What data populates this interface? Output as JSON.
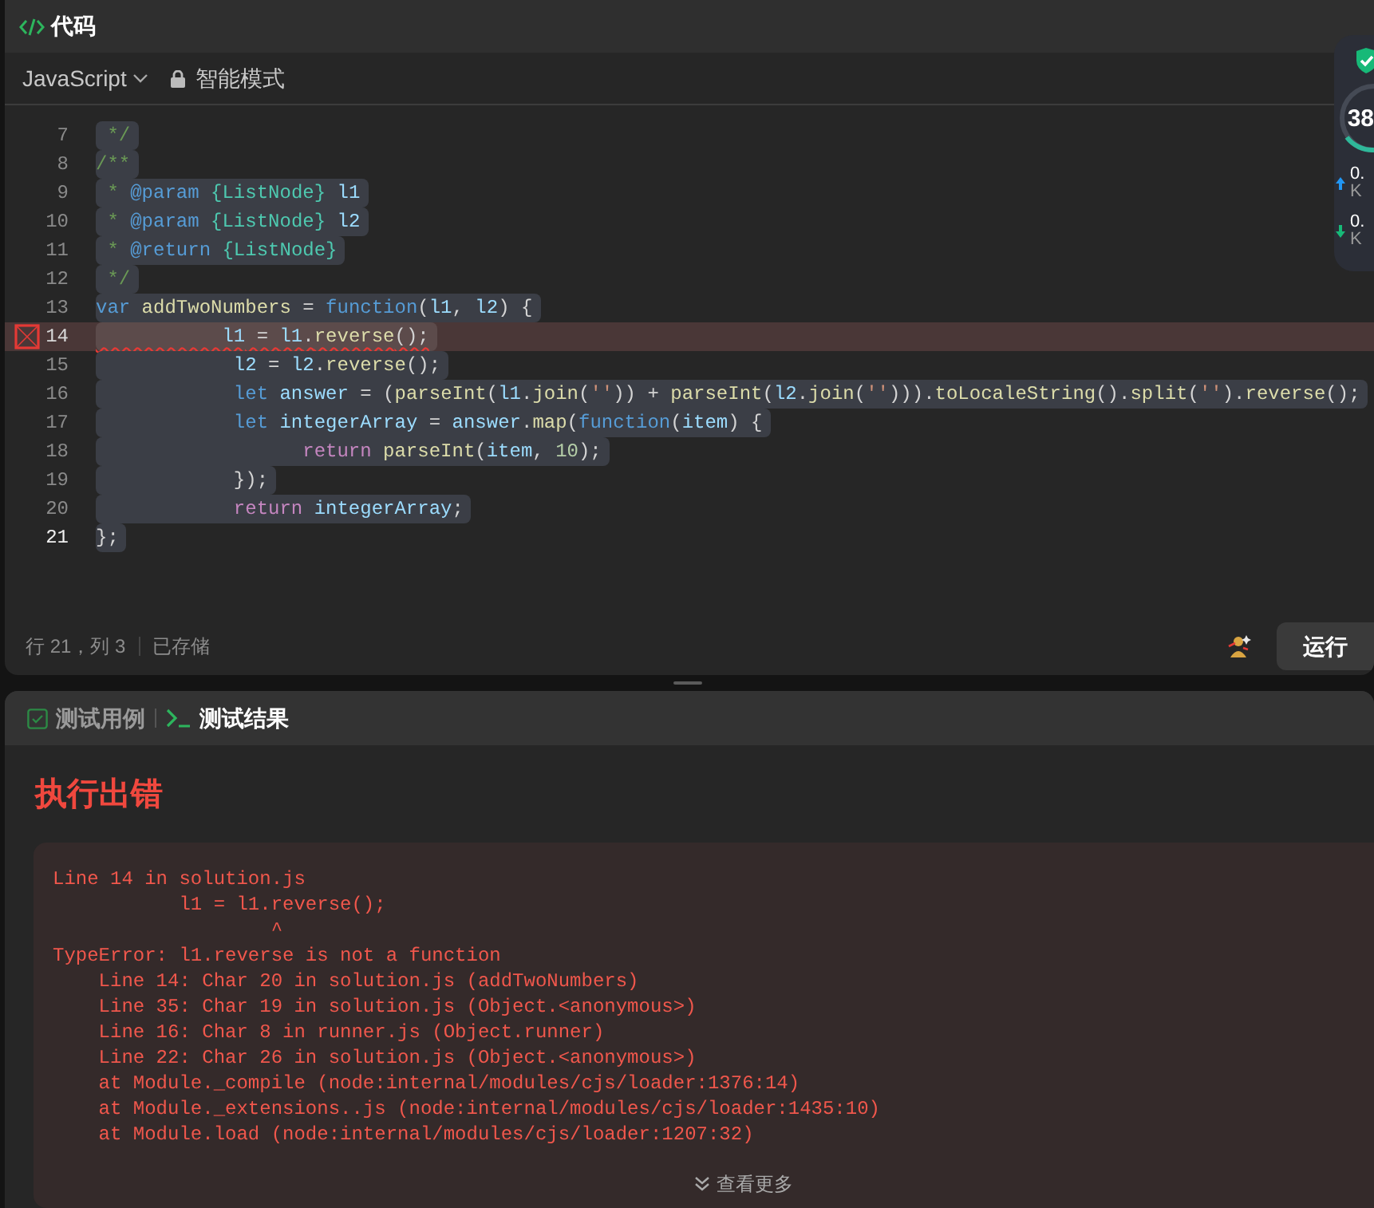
{
  "editor": {
    "title": "代码",
    "language": "JavaScript",
    "mode": "智能模式",
    "lines": [
      {
        "number": "7",
        "selected": true,
        "error": false,
        "current": false,
        "tokens": [
          {
            "text": " */",
            "kind": "comment"
          }
        ]
      },
      {
        "number": "8",
        "selected": true,
        "error": false,
        "current": false,
        "tokens": [
          {
            "text": "/**",
            "kind": "comment"
          }
        ]
      },
      {
        "number": "9",
        "selected": true,
        "error": false,
        "current": false,
        "tokens": [
          {
            "text": " * ",
            "kind": "comment"
          },
          {
            "text": "@param",
            "kind": "tag"
          },
          {
            "text": " {ListNode}",
            "kind": "type"
          },
          {
            "text": " l1",
            "kind": "var"
          }
        ]
      },
      {
        "number": "10",
        "selected": true,
        "error": false,
        "current": false,
        "tokens": [
          {
            "text": " * ",
            "kind": "comment"
          },
          {
            "text": "@param",
            "kind": "tag"
          },
          {
            "text": " {ListNode}",
            "kind": "type"
          },
          {
            "text": " l2",
            "kind": "var"
          }
        ]
      },
      {
        "number": "11",
        "selected": true,
        "error": false,
        "current": false,
        "tokens": [
          {
            "text": " * ",
            "kind": "comment"
          },
          {
            "text": "@return",
            "kind": "tag"
          },
          {
            "text": " {ListNode}",
            "kind": "type"
          }
        ]
      },
      {
        "number": "12",
        "selected": true,
        "error": false,
        "current": false,
        "tokens": [
          {
            "text": " */",
            "kind": "comment"
          }
        ]
      },
      {
        "number": "13",
        "selected": true,
        "error": false,
        "current": false,
        "tokens": [
          {
            "text": "var",
            "kind": "kw"
          },
          {
            "text": " addTwoNumbers",
            "kind": "fn"
          },
          {
            "text": " = ",
            "kind": "plain"
          },
          {
            "text": "function",
            "kind": "kw"
          },
          {
            "text": "(",
            "kind": "plain"
          },
          {
            "text": "l1",
            "kind": "var"
          },
          {
            "text": ", ",
            "kind": "plain"
          },
          {
            "text": "l2",
            "kind": "var"
          },
          {
            "text": ") {",
            "kind": "plain"
          }
        ]
      },
      {
        "number": "14",
        "selected": true,
        "error": true,
        "current": false,
        "tokens": [
          {
            "text": "           l1",
            "kind": "var"
          },
          {
            "text": " = ",
            "kind": "plain"
          },
          {
            "text": "l1",
            "kind": "var"
          },
          {
            "text": ".",
            "kind": "plain"
          },
          {
            "text": "reverse",
            "kind": "fn"
          },
          {
            "text": "();",
            "kind": "plain"
          }
        ]
      },
      {
        "number": "15",
        "selected": true,
        "error": false,
        "current": false,
        "tokens": [
          {
            "text": "            l2",
            "kind": "var"
          },
          {
            "text": " = ",
            "kind": "plain"
          },
          {
            "text": "l2",
            "kind": "var"
          },
          {
            "text": ".",
            "kind": "plain"
          },
          {
            "text": "reverse",
            "kind": "fn"
          },
          {
            "text": "();",
            "kind": "plain"
          }
        ]
      },
      {
        "number": "16",
        "selected": true,
        "error": false,
        "current": false,
        "tokens": [
          {
            "text": "            let",
            "kind": "kw"
          },
          {
            "text": " answer",
            "kind": "var"
          },
          {
            "text": " = (",
            "kind": "plain"
          },
          {
            "text": "parseInt",
            "kind": "fn"
          },
          {
            "text": "(",
            "kind": "plain"
          },
          {
            "text": "l1",
            "kind": "var"
          },
          {
            "text": ".",
            "kind": "plain"
          },
          {
            "text": "join",
            "kind": "fn"
          },
          {
            "text": "(",
            "kind": "plain"
          },
          {
            "text": "''",
            "kind": "str"
          },
          {
            "text": ")) + ",
            "kind": "plain"
          },
          {
            "text": "parseInt",
            "kind": "fn"
          },
          {
            "text": "(",
            "kind": "plain"
          },
          {
            "text": "l2",
            "kind": "var"
          },
          {
            "text": ".",
            "kind": "plain"
          },
          {
            "text": "join",
            "kind": "fn"
          },
          {
            "text": "(",
            "kind": "plain"
          },
          {
            "text": "''",
            "kind": "str"
          },
          {
            "text": "))).",
            "kind": "plain"
          },
          {
            "text": "toLocaleString",
            "kind": "fn"
          },
          {
            "text": "().",
            "kind": "plain"
          },
          {
            "text": "split",
            "kind": "fn"
          },
          {
            "text": "(",
            "kind": "plain"
          },
          {
            "text": "''",
            "kind": "str"
          },
          {
            "text": ").",
            "kind": "plain"
          },
          {
            "text": "reverse",
            "kind": "fn"
          },
          {
            "text": "();",
            "kind": "plain"
          }
        ]
      },
      {
        "number": "17",
        "selected": true,
        "error": false,
        "current": false,
        "tokens": [
          {
            "text": "            let",
            "kind": "kw"
          },
          {
            "text": " integerArray",
            "kind": "var"
          },
          {
            "text": " = ",
            "kind": "plain"
          },
          {
            "text": "answer",
            "kind": "var"
          },
          {
            "text": ".",
            "kind": "plain"
          },
          {
            "text": "map",
            "kind": "fn"
          },
          {
            "text": "(",
            "kind": "plain"
          },
          {
            "text": "function",
            "kind": "kw"
          },
          {
            "text": "(",
            "kind": "plain"
          },
          {
            "text": "item",
            "kind": "var"
          },
          {
            "text": ") {",
            "kind": "plain"
          }
        ]
      },
      {
        "number": "18",
        "selected": true,
        "error": false,
        "current": false,
        "tokens": [
          {
            "text": "                  return",
            "kind": "ctrl"
          },
          {
            "text": " parseInt",
            "kind": "fn"
          },
          {
            "text": "(",
            "kind": "plain"
          },
          {
            "text": "item",
            "kind": "var"
          },
          {
            "text": ", ",
            "kind": "plain"
          },
          {
            "text": "10",
            "kind": "num"
          },
          {
            "text": ");",
            "kind": "plain"
          }
        ]
      },
      {
        "number": "19",
        "selected": true,
        "error": false,
        "current": false,
        "tokens": [
          {
            "text": "            });",
            "kind": "plain"
          }
        ]
      },
      {
        "number": "20",
        "selected": true,
        "error": false,
        "current": false,
        "tokens": [
          {
            "text": "            return",
            "kind": "ctrl"
          },
          {
            "text": " integerArray",
            "kind": "var"
          },
          {
            "text": ";",
            "kind": "plain"
          }
        ]
      },
      {
        "number": "21",
        "selected": true,
        "error": false,
        "current": true,
        "tokens": [
          {
            "text": "};",
            "kind": "plain"
          }
        ]
      }
    ],
    "status": {
      "position": "行 21，列 3",
      "saved": "已存储"
    },
    "run_button": "运行"
  },
  "overlay": {
    "score": "38",
    "upload": {
      "value": "0.",
      "unit": "K"
    },
    "download": {
      "value": "0.",
      "unit": "K"
    }
  },
  "test_panel": {
    "tabs": [
      {
        "label": "测试用例",
        "kind": "cases",
        "selected": false
      },
      {
        "label": "测试结果",
        "kind": "result",
        "selected": true
      }
    ],
    "result": {
      "title": "执行出错",
      "output": [
        "Line 14 in solution.js",
        "           l1 = l1.reverse();",
        "                   ^",
        "TypeError: l1.reverse is not a function",
        "    Line 14: Char 20 in solution.js (addTwoNumbers)",
        "    Line 35: Char 19 in solution.js (Object.<anonymous>)",
        "    Line 16: Char 8 in runner.js (Object.runner)",
        "    Line 22: Char 26 in solution.js (Object.<anonymous>)",
        "    at Module._compile (node:internal/modules/cjs/loader:1376:14)",
        "    at Module._extensions..js (node:internal/modules/cjs/loader:1435:10)",
        "    at Module.load (node:internal/modules/cjs/loader:1207:32)"
      ],
      "more": "查看更多"
    }
  }
}
